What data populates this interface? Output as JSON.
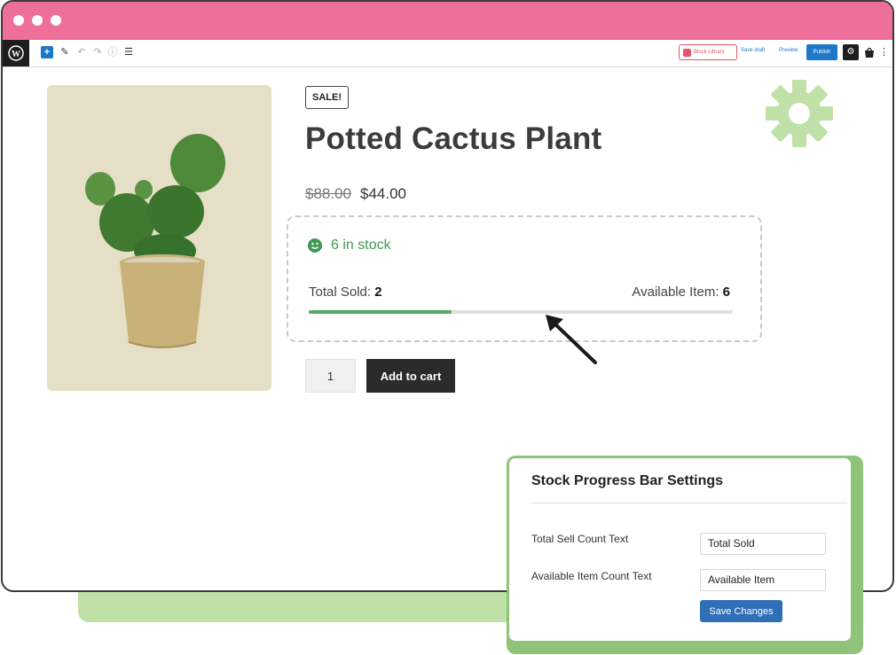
{
  "toolbar": {
    "block_library_label": "Block Library",
    "save_draft_label": "Save draft",
    "preview_label": "Preview",
    "publish_label": "Publish"
  },
  "product": {
    "sale_badge": "SALE!",
    "title": "Potted Cactus Plant",
    "old_price": "$88.00",
    "price": "$44.00",
    "stock_text": "6 in stock",
    "total_sold_label": "Total Sold:",
    "total_sold_value": "2",
    "available_label": "Available Item:",
    "available_value": "6",
    "progress_fraction": 0.3366,
    "quantity": "1",
    "add_to_cart_label": "Add to cart"
  },
  "settings_panel": {
    "title": "Stock Progress Bar Settings",
    "fields": [
      {
        "label": "Total Sell Count Text",
        "value": "Total Sold"
      },
      {
        "label": "Available Item Count Text",
        "value": "Available Item"
      }
    ],
    "save_label": "Save Changes"
  },
  "colors": {
    "titlebar": "#ef6f9b",
    "accent_blue": "#1e78c8",
    "stock_green": "#3f9a55",
    "gear_green": "#bfe0a6"
  },
  "icons": {
    "gear": "gear-icon",
    "arrow": "arrow-pointer-icon",
    "smile": "smile-icon"
  }
}
